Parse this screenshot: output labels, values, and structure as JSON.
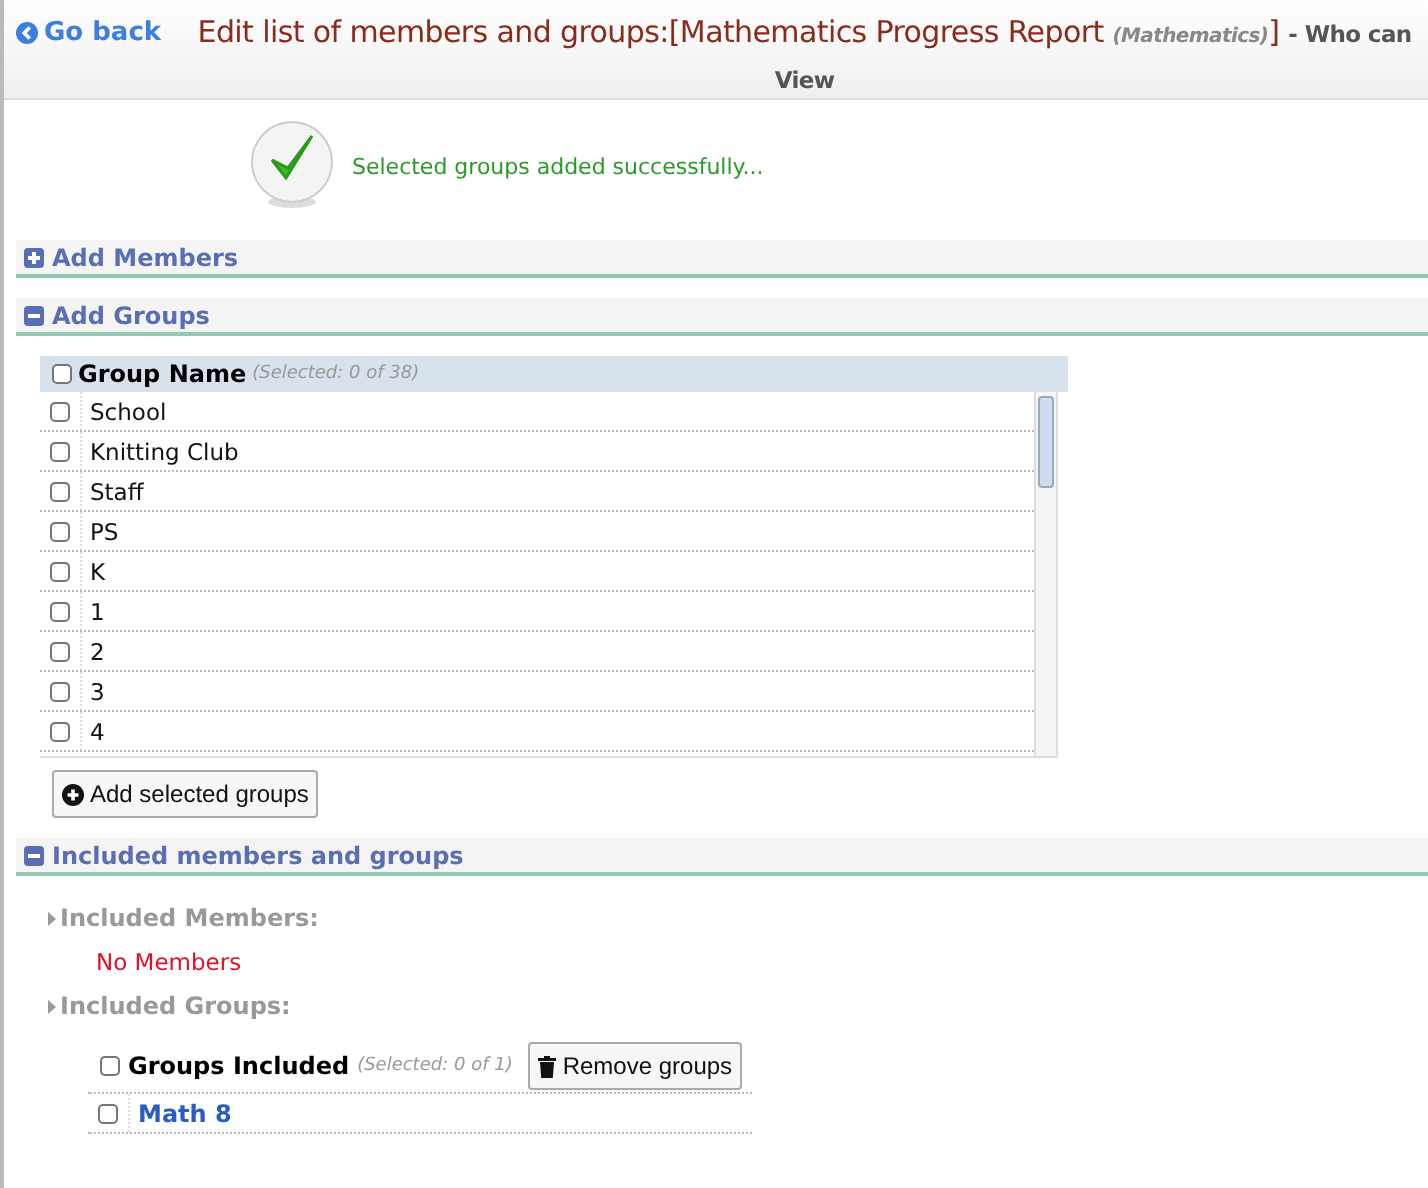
{
  "header": {
    "back_link": "Go back",
    "title": "Edit list of members and groups:[Mathematics Progress Report ",
    "title_note": "(Mathematics)",
    "title_end": "]",
    "suffix": "- Who can View"
  },
  "message": {
    "text": "Selected groups added successfully..."
  },
  "add_members": {
    "label": "Add Members",
    "expanded": false
  },
  "add_groups": {
    "label": "Add Groups",
    "expanded": true,
    "table": {
      "header": "Group Name",
      "count": "(Selected: 0 of 38)",
      "all_checked": false,
      "rows": [
        {
          "name": "School",
          "checked": false
        },
        {
          "name": "Knitting Club",
          "checked": false
        },
        {
          "name": "Staff",
          "checked": false
        },
        {
          "name": "PS",
          "checked": false
        },
        {
          "name": "K",
          "checked": false
        },
        {
          "name": "1",
          "checked": false
        },
        {
          "name": "2",
          "checked": false
        },
        {
          "name": "3",
          "checked": false
        },
        {
          "name": "4",
          "checked": false
        }
      ]
    },
    "button": "Add selected groups"
  },
  "included": {
    "label": "Included members and groups",
    "expanded": true,
    "members_label": "Included Members:",
    "members_empty": "No Members",
    "groups_label": "Included Groups:",
    "groups_header": "Groups Included",
    "groups_count": "(Selected: 0 of 1)",
    "all_checked": false,
    "remove_button": "Remove groups",
    "groups": [
      {
        "name": "Math 8",
        "checked": false
      }
    ]
  }
}
